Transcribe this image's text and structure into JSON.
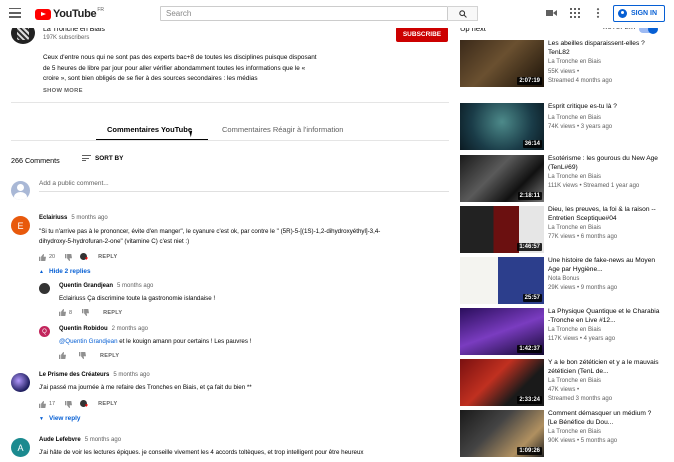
{
  "header": {
    "logo_text": "YouTube",
    "country": "FR",
    "search_placeholder": "Search",
    "sign_in": "SIGN IN"
  },
  "channel": {
    "name": "La Tronche en Biais",
    "subscribers": "197K subscribers",
    "subscribe_label": "SUBSCRIBE"
  },
  "description": {
    "lines": [
      "Ceux d'entre nous qui ne sont pas des experts bac+8 de toutes les disciplines puisque disposant",
      "de 5 heures de libre par jour pour aller vérifier abondamment toutes les informations que le «",
      "croire », sont bien obligés de se fier à des sources secondaires : les médias"
    ],
    "show_more": "SHOW MORE"
  },
  "tabs": {
    "active": "Commentaires YouTube",
    "inactive": "Commentaires Réagir à l'information"
  },
  "comments_header": {
    "count": "266 Comments",
    "sort_by": "SORT BY",
    "add_placeholder": "Add a public comment..."
  },
  "comments": [
    {
      "author": "Eclairiuss",
      "time": "5 months ago",
      "avatar_letter": "E",
      "avatar_color": "#e8590c",
      "text": [
        "\"Si tu n'arrive pas à le prononcer, évite d'en manger\", le cyanure c'est ok, par contre le \" (5R)-5-[(1S)-1,2-dihydroxyéthyl]-3,4-",
        "dihydroxy-5-hydrofuran-2-one\" (vitamine C) c'est niet :)"
      ],
      "likes": "20",
      "reply": "REPLY",
      "replies_toggle": "Hide 2 replies"
    },
    {
      "author": "Quentin Grandjean",
      "time": "5 months ago",
      "text": [
        "Eclairiuss Ça discrimine toute la gastronomie islandaise !"
      ],
      "likes": "8",
      "reply": "REPLY"
    },
    {
      "author": "Quentin Robidou",
      "time": "2 months ago",
      "avatar_letter": "Q",
      "avatar_color": "#c2255c",
      "mention": "@Quentin Grandjean",
      "text": [
        " et le kouign amann pour certains ! Les pauvres !"
      ],
      "likes": "",
      "reply": "REPLY"
    },
    {
      "author": "Le Prisme des Créateurs",
      "time": "5 months ago",
      "text": [
        "J'ai passé ma journée à me refaire des Tronches en Biais, et ça fait du bien **"
      ],
      "likes": "17",
      "reply": "REPLY",
      "replies_toggle": "View reply"
    },
    {
      "author": "Aude Lefebvre",
      "time": "5 months ago",
      "avatar_letter": "A",
      "avatar_color": "#1b8a8f",
      "text": [
        "J'ai hâte de voir les lectures épiques. je conseille vivement les 4 accords toltèques, et trop intelligent pour être heureux"
      ]
    }
  ],
  "sidebar": {
    "up_next": "Up next",
    "autoplay": "AUTOPLAY",
    "videos": [
      {
        "title": "Les abeilles disparaissent-elles ? TenL82",
        "channel": "La Tronche en Biais",
        "meta": "55K views •",
        "meta2": "Streamed 4 months ago",
        "duration": "2:07:19"
      },
      {
        "title": "Esprit critique es-tu là ?",
        "channel": "La Tronche en Biais",
        "meta": "74K views • 3 years ago",
        "duration": "36:14"
      },
      {
        "title": "Esotérisme : les gourous du New Age (TenL#69)",
        "channel": "La Tronche en Biais",
        "meta": "111K views • Streamed 1 year ago",
        "duration": "2:18:11"
      },
      {
        "title": "Dieu, les preuves, la foi & la raison -- Entretien Sceptique#04",
        "channel": "La Tronche en Biais",
        "meta": "77K views • 6 months ago",
        "duration": "1:46:57"
      },
      {
        "title": "Une histoire de fake-news au Moyen Age par Hygiène...",
        "channel": "Nota Bonus",
        "meta": "29K views • 9 months ago",
        "duration": "25:57"
      },
      {
        "title": "La Physique Quantique et le Charabia -Tronche en Live #12...",
        "channel": "La Tronche en Biais",
        "meta": "117K views • 4 years ago",
        "duration": "1:42:37"
      },
      {
        "title": "Y a le bon zététicien et y a le mauvais zététicien (TenL de...",
        "channel": "La Tronche en Biais",
        "meta": "47K views •",
        "meta2": "Streamed 3 months ago",
        "duration": "2:33:24"
      },
      {
        "title": "Comment démasquer un médium ? [Le Bénéfice du Dou...",
        "channel": "La Tronche en Biais",
        "meta": "90K views • 5 months ago",
        "duration": "1:09:26"
      }
    ]
  }
}
